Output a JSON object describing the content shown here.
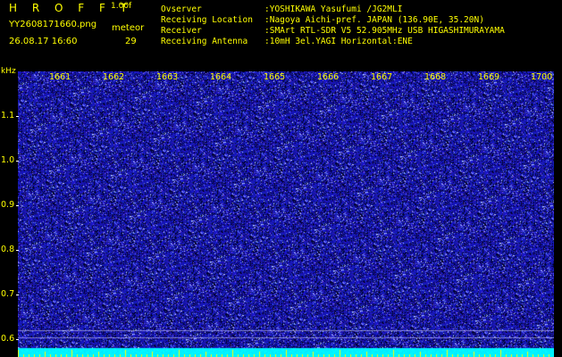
{
  "header": {
    "app_title": "H R O F F T",
    "version": "1.00f",
    "filename": "YY2608171660.png",
    "datetime": "26.08.17 16:60",
    "meteor_label": "meteor",
    "meteor_count": "29"
  },
  "info": [
    {
      "label": "Ovserver",
      "value": ":YOSHIKAWA Yasufumi /JG2MLI"
    },
    {
      "label": "Receiving Location",
      "value": ":Nagoya Aichi-pref. JAPAN (136.90E, 35.20N)"
    },
    {
      "label": "Receiver",
      "value": ":SMArt RTL-SDR V5 52.905MHz USB HIGASHIMURAYAMA"
    },
    {
      "label": "Receiving Antenna",
      "value": ":10mH 3el.YAGI Horizontal:ENE"
    }
  ],
  "spectrogram": {
    "freq_unit": "kHz",
    "freq_ticks": [
      "1.1",
      "1.0",
      "0.9",
      "0.8",
      "0.7",
      "0.6"
    ],
    "time_ticks": [
      "1661",
      "1662",
      "1663",
      "1664",
      "1665",
      "1666",
      "1667",
      "1668",
      "1669",
      "1700"
    ]
  },
  "colors": {
    "background": "#000000",
    "text_primary": "#ffff00",
    "text_info": "#ffffff",
    "noise_base": "#1a1ab4",
    "noise_highlight": "#7878ff",
    "baseline_band": "#00ffff"
  }
}
